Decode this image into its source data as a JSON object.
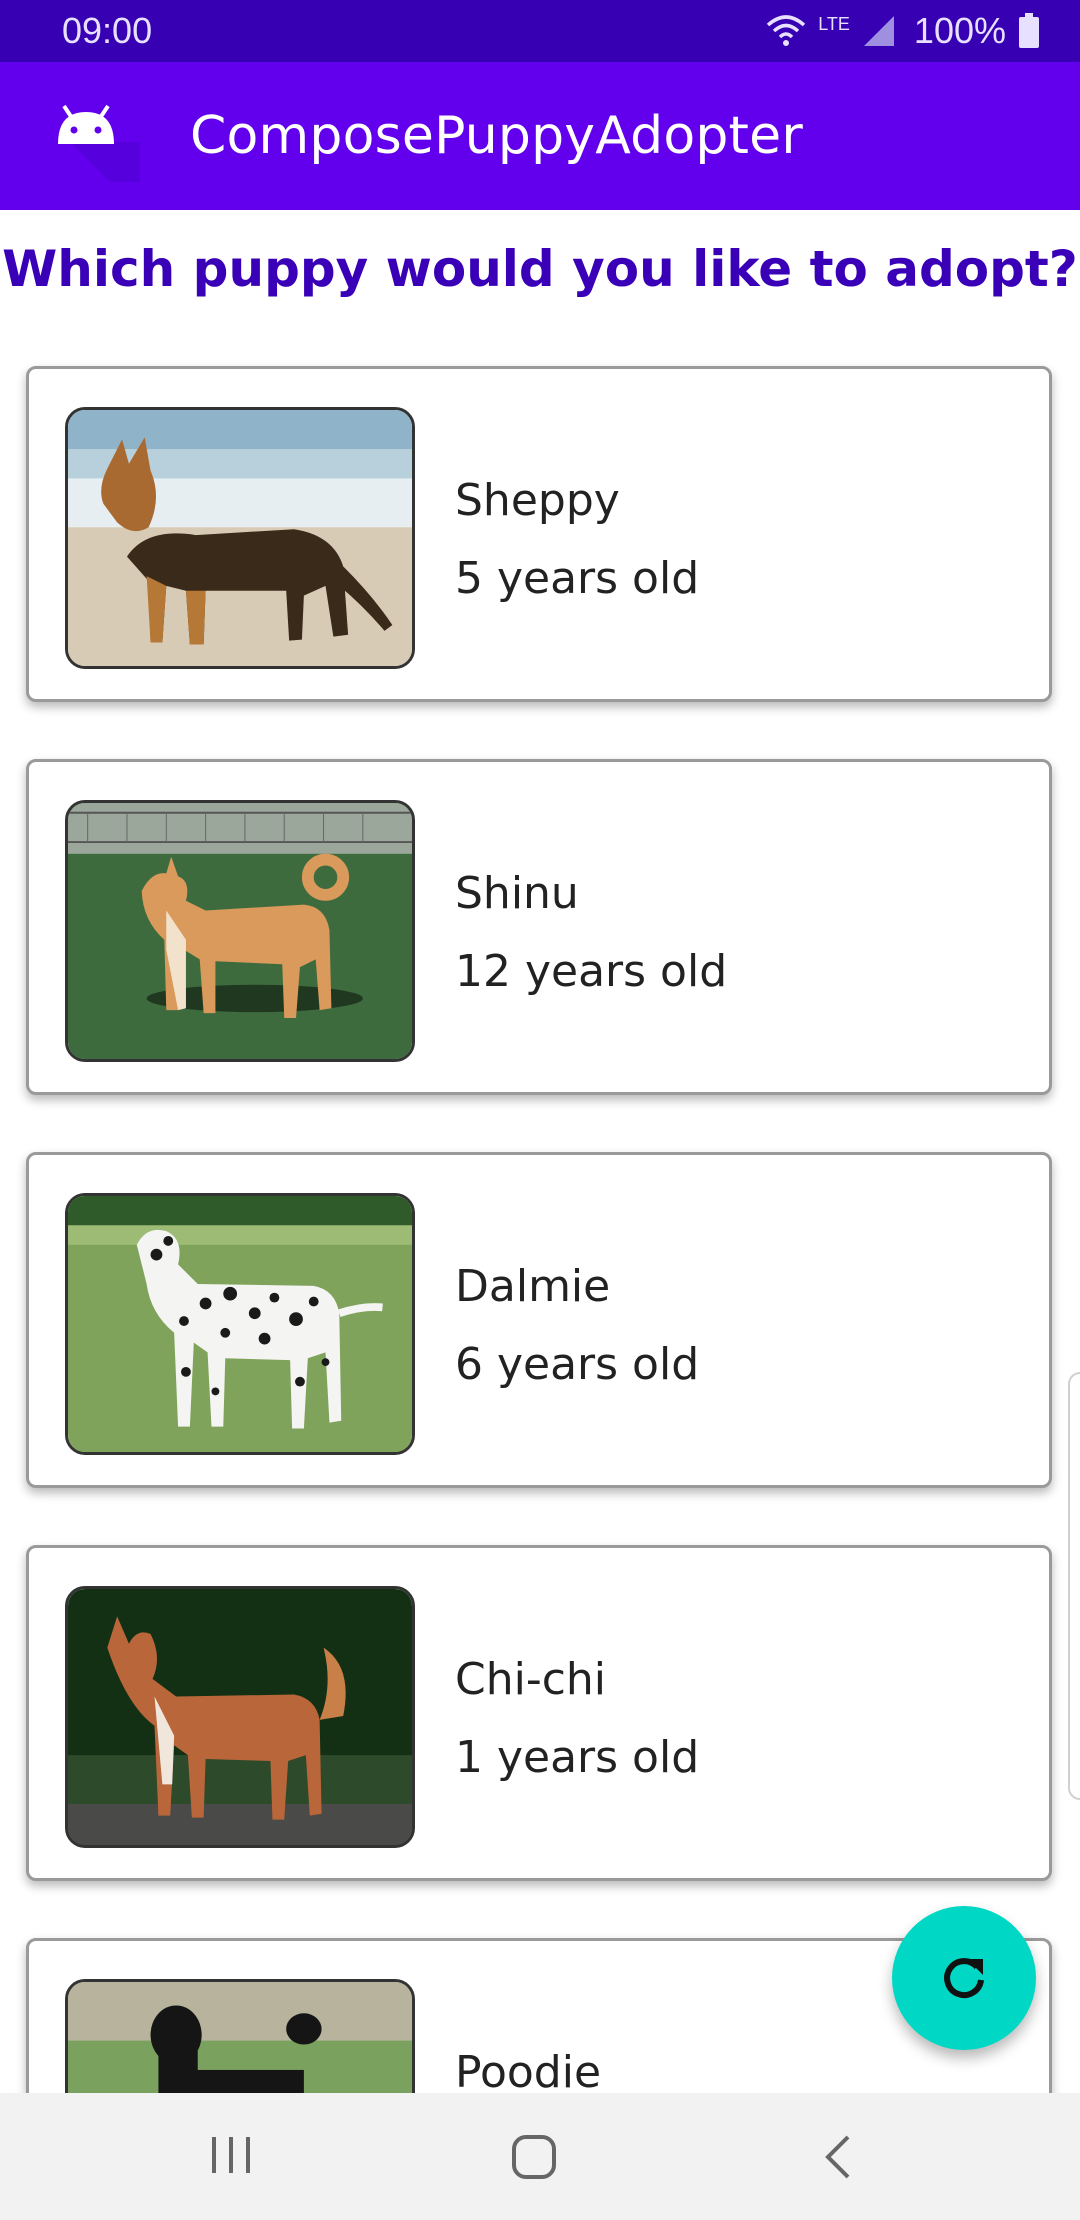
{
  "status_bar": {
    "time": "09:00",
    "network": "LTE",
    "battery": "100%"
  },
  "app_bar": {
    "title": "ComposePuppyAdopter",
    "logo_icon": "android-icon"
  },
  "heading": "Which puppy would you like to adopt?",
  "puppies": [
    {
      "name": "Sheppy",
      "age": "5 years old",
      "photo": "german-shepherd-photo"
    },
    {
      "name": "Shinu",
      "age": "12 years old",
      "photo": "shiba-inu-photo"
    },
    {
      "name": "Dalmie",
      "age": "6 years old",
      "photo": "dalmatian-photo"
    },
    {
      "name": "Chi-chi",
      "age": "1 years old",
      "photo": "chihuahua-photo"
    },
    {
      "name": "Poodie",
      "age": "",
      "photo": "poodle-photo"
    }
  ],
  "fab": {
    "icon": "refresh-icon"
  },
  "nav_bar": {
    "icons": [
      "recent-apps-icon",
      "home-icon",
      "back-icon"
    ]
  },
  "colors": {
    "status_bar": "#3700b3",
    "app_bar": "#6200ee",
    "heading": "#3a00b8",
    "fab": "#00d8c5"
  }
}
